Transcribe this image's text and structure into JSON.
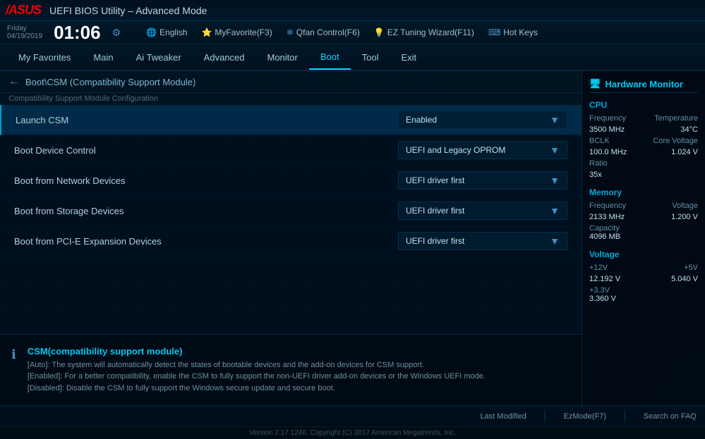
{
  "topbar": {
    "logo": "/ASUS",
    "title": "UEFI BIOS Utility – Advanced Mode"
  },
  "timebar": {
    "day": "Friday",
    "date": "04/19/2019",
    "time": "01:06",
    "lang": "English",
    "myfavorite": "MyFavorite(F3)",
    "qfan": "Qfan Control(F6)",
    "eztuning": "EZ Tuning Wizard(F11)",
    "hotkeys": "Hot Keys"
  },
  "nav": {
    "items": [
      {
        "label": "My Favorites",
        "active": false
      },
      {
        "label": "Main",
        "active": false
      },
      {
        "label": "Ai Tweaker",
        "active": false
      },
      {
        "label": "Advanced",
        "active": false
      },
      {
        "label": "Monitor",
        "active": false
      },
      {
        "label": "Boot",
        "active": true
      },
      {
        "label": "Tool",
        "active": false
      },
      {
        "label": "Exit",
        "active": false
      }
    ]
  },
  "breadcrumb": {
    "path": "Boot\\CSM (Compatibility Support Module)",
    "sub": "Compatibility Support Module Configuration"
  },
  "settings": {
    "rows": [
      {
        "label": "Launch CSM",
        "value": "Enabled",
        "highlighted": true
      },
      {
        "label": "Boot Device Control",
        "value": "UEFI and Legacy OPROM",
        "highlighted": false
      },
      {
        "label": "Boot from Network Devices",
        "value": "UEFI driver first",
        "highlighted": false
      },
      {
        "label": "Boot from Storage Devices",
        "value": "UEFI driver first",
        "highlighted": false
      },
      {
        "label": "Boot from PCI-E Expansion Devices",
        "value": "UEFI driver first",
        "highlighted": false
      }
    ]
  },
  "info": {
    "title": "CSM(compatibility support module)",
    "lines": [
      "[Auto]: The system will automatically detect the states of bootable devices and the add-on devices for CSM support.",
      "[Enabled]: For a better compatibility, enable the CSM to fully support the non-UEFI driver add-on devices or the Windows UEFI mode.",
      "[Disabled]: Disable the CSM to fully support the Windows secure update and secure boot."
    ]
  },
  "sidebar": {
    "title": "Hardware Monitor",
    "cpu": {
      "section": "CPU",
      "frequency_label": "Frequency",
      "frequency_value": "3500 MHz",
      "temperature_label": "Temperature",
      "temperature_value": "34°C",
      "bclk_label": "BCLK",
      "bclk_value": "100.0 MHz",
      "corevoltage_label": "Core Voltage",
      "corevoltage_value": "1.024 V",
      "ratio_label": "Ratio",
      "ratio_value": "35x"
    },
    "memory": {
      "section": "Memory",
      "frequency_label": "Frequency",
      "frequency_value": "2133 MHz",
      "voltage_label": "Voltage",
      "voltage_value": "1.200 V",
      "capacity_label": "Capacity",
      "capacity_value": "4096 MB"
    },
    "voltage": {
      "section": "Voltage",
      "v12_label": "+12V",
      "v12_value": "12.192 V",
      "v5_label": "+5V",
      "v5_value": "5.040 V",
      "v33_label": "+3.3V",
      "v33_value": "3.360 V"
    }
  },
  "bottombar": {
    "last_modified": "Last Modified",
    "ezmode": "EzMode(F7)",
    "search": "Search on FAQ"
  },
  "versionbar": {
    "text": "Version 2.17.1246. Copyright (C) 2017 American Megatrends, Inc."
  }
}
